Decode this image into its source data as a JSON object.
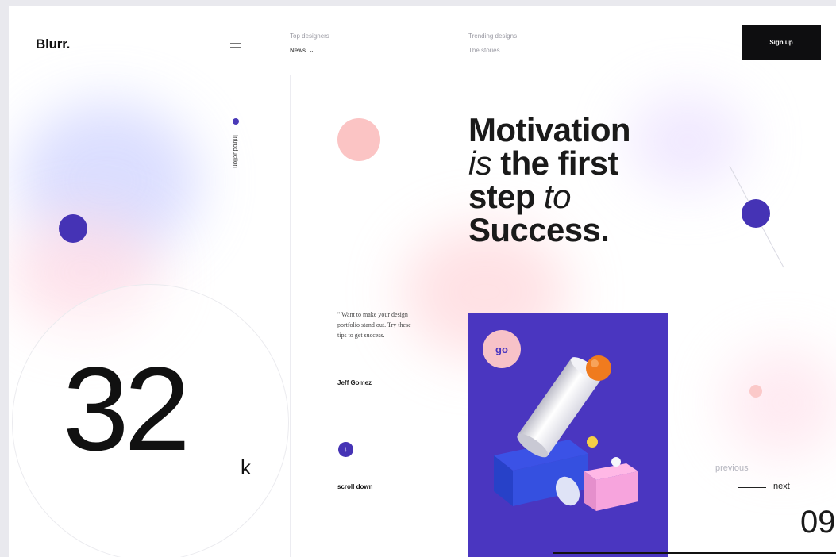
{
  "header": {
    "logo": "Blurr.",
    "nav": [
      {
        "small": "Top designers",
        "main": "News",
        "has_chevron": true
      },
      {
        "small": "Trending designs",
        "main": "The stories",
        "has_chevron": false
      }
    ],
    "chevron_glyph": "⌄",
    "signup_label": "Sign up"
  },
  "left": {
    "section_label": "Introduction",
    "stat_value": "32",
    "stat_suffix": "k"
  },
  "main": {
    "headline": {
      "line1": "Motivation",
      "line2_italic": "is",
      "line2_bold": "the first",
      "line3_bold": "step",
      "line3_italic": "to",
      "line4": "Success."
    },
    "quote": "\" Want to make your design portfolio stand out. Try these tips to get success.",
    "author": "Jeff Gomez",
    "scroll_icon": "↓",
    "scroll_label": "scroll down",
    "card_badge": "go"
  },
  "right": {
    "previous_label": "previous",
    "next_label": "next",
    "page_number": "09"
  },
  "colors": {
    "accent": "#4533b5",
    "pink": "#fbc4c4",
    "card_bg": "#4a36c0",
    "button_bg": "#0e0e10"
  }
}
